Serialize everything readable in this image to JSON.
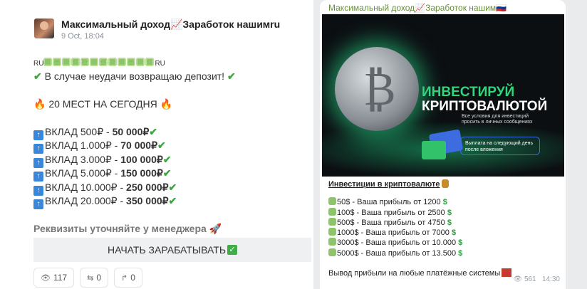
{
  "left_post": {
    "channel_title": "Максимальный доход📈Заработок нашимru",
    "date": "9 Oct, 18:04",
    "lines": {
      "prefix": "RU",
      "suffix": "RU",
      "deposit_return": "В случае неудачи возвращаю депозит!",
      "places": "20 МЕСТ НА СЕГОДНЯ",
      "deposits": [
        {
          "label": "ВКЛАД 500₽ - ",
          "profit": "50 000₽"
        },
        {
          "label": "ВКЛАД 1.000₽ - ",
          "profit": "70 000₽"
        },
        {
          "label": "ВКЛАД 3.000₽ - ",
          "profit": "100 000₽"
        },
        {
          "label": "ВКЛАД 5.000₽ - ",
          "profit": "150 000₽"
        },
        {
          "label": "ВКЛАД 10.000₽ - ",
          "profit": "250 000₽"
        },
        {
          "label": "ВКЛАД 20.000₽ - ",
          "profit": "350 000₽"
        }
      ],
      "manager": "Реквизиты уточняйте у менеджера 🚀"
    },
    "cta_label": "НАЧАТЬ ЗАРАБАТЫВАТЬ",
    "stats": {
      "views": "117",
      "shares": "0",
      "replies": "0"
    }
  },
  "right_post": {
    "title": "Максимальный доход📈Заработок нашим🇷🇺",
    "banner": {
      "headline_1": "ИНВЕСТИРУЙ",
      "headline_2": "КРИПТОВАЛЮТОЙ",
      "sub": "Все условия для инвестиций просить в личных сообщениях",
      "pill": "Выплата на следующий день после вложения"
    },
    "heading": "Инвестиции в криптовалюте",
    "offers": [
      {
        "amount": "50$",
        "text": " - Ваша прибыль от 1200"
      },
      {
        "amount": "100$",
        "text": " - Ваша прибыль от 2500"
      },
      {
        "amount": "500$",
        "text": " - Ваша прибыль от 4750"
      },
      {
        "amount": "1000$",
        "text": " - Ваша прибыль от 7000"
      },
      {
        "amount": "3000$",
        "text": " - Ваша прибыль от 10.000"
      },
      {
        "amount": "5000$",
        "text": " - Ваша прибыль от 13.500"
      }
    ],
    "withdrawal": "Вывод прибыли на любые платёжные системы",
    "views": "561",
    "time": "14:30"
  },
  "colors": {
    "accent_green": "#3aa640",
    "title_green": "#6a8f3a",
    "banner_glow": "#2fd67a"
  }
}
